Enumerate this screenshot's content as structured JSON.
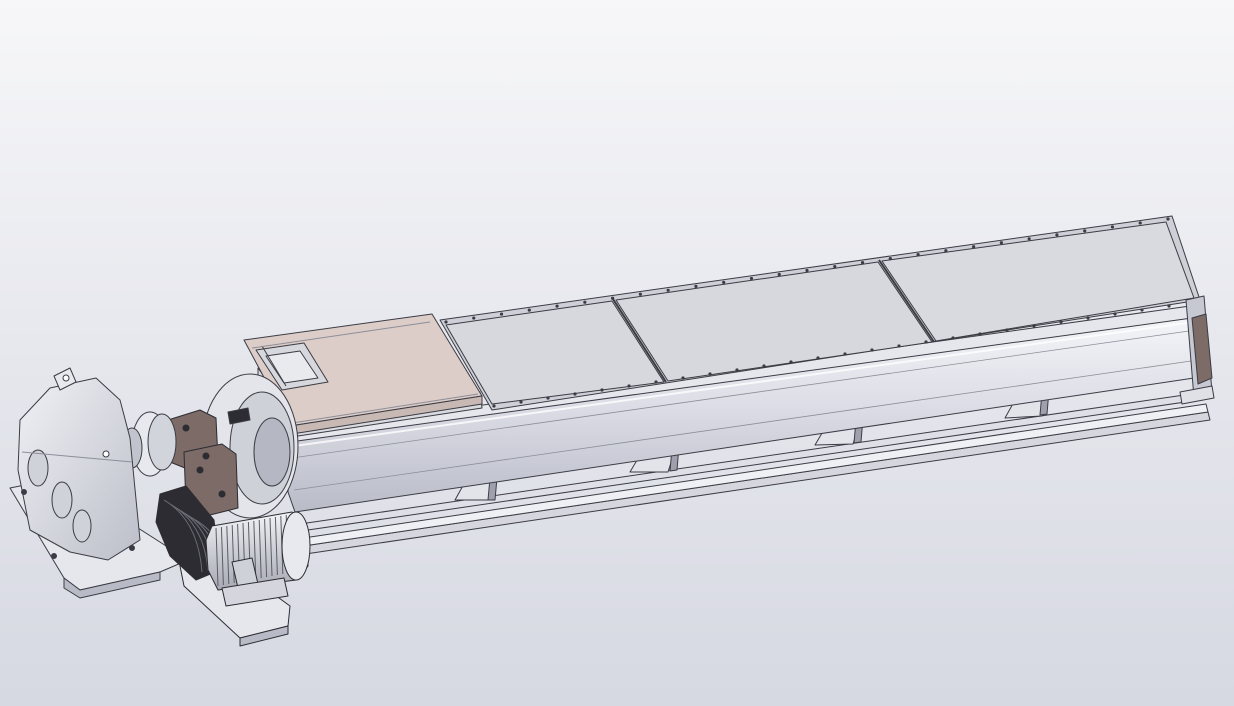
{
  "viewport": {
    "background_top": "#f7f7f9",
    "background_bottom": "#d6d8e2"
  },
  "model": {
    "name": "",
    "colors": {
      "steel": "#d9dae3",
      "steel_light": "#eceef3",
      "steel_dark": "#9ea1ad",
      "edge": "#3b3c44",
      "cover_panel": "#d7d8dd",
      "inlet_plate": "#dccdc8",
      "bearing_housing": "#7c6b66",
      "pulley_dark": "#2c2c32",
      "motor_fins": "#5a5c66"
    }
  }
}
